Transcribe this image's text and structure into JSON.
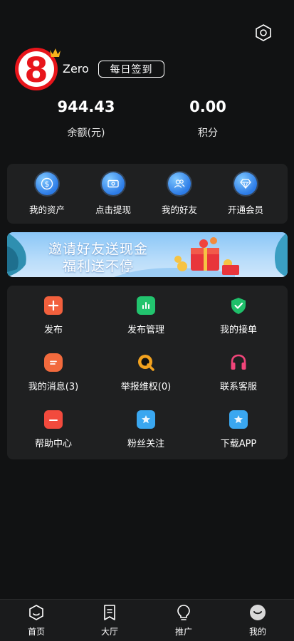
{
  "profile": {
    "username": "Zero",
    "checkin_label": "每日签到",
    "avatar_digit": "8"
  },
  "stats": {
    "balance_value": "944.43",
    "balance_label": "余额(元)",
    "points_value": "0.00",
    "points_label": "积分"
  },
  "quick_actions": [
    {
      "label": "我的资产",
      "icon": "dollar-coin-icon"
    },
    {
      "label": "点击提现",
      "icon": "cash-note-icon"
    },
    {
      "label": "我的好友",
      "icon": "friends-icon"
    },
    {
      "label": "开通会员",
      "icon": "diamond-icon"
    }
  ],
  "banner": {
    "line1": "邀请好友送现金",
    "line2": "福利送不停"
  },
  "grid": [
    {
      "label": "发布",
      "icon": "plus-icon",
      "color": "#f2603d"
    },
    {
      "label": "发布管理",
      "icon": "bar-chart-icon",
      "color": "#22c46e"
    },
    {
      "label": "我的接单",
      "icon": "shield-check-icon",
      "color": "#1fbf6a"
    },
    {
      "label": "我的消息(3)",
      "icon": "message-icon",
      "color": "#f26a3d"
    },
    {
      "label": "举报维权(0)",
      "icon": "magnifier-icon",
      "color": "#f2a21f"
    },
    {
      "label": "联系客服",
      "icon": "headset-icon",
      "color": "#f2457a"
    },
    {
      "label": "帮助中心",
      "icon": "calendar-icon",
      "color": "#f24a3d"
    },
    {
      "label": "粉丝关注",
      "icon": "star-icon",
      "color": "#3aa7f0"
    },
    {
      "label": "下载APP",
      "icon": "star-icon",
      "color": "#3aa7f0"
    }
  ],
  "tabbar": [
    {
      "label": "首页",
      "icon": "home-icon"
    },
    {
      "label": "大厅",
      "icon": "bookmark-icon"
    },
    {
      "label": "推广",
      "icon": "lightbulb-icon"
    },
    {
      "label": "我的",
      "icon": "profile-icon"
    }
  ]
}
